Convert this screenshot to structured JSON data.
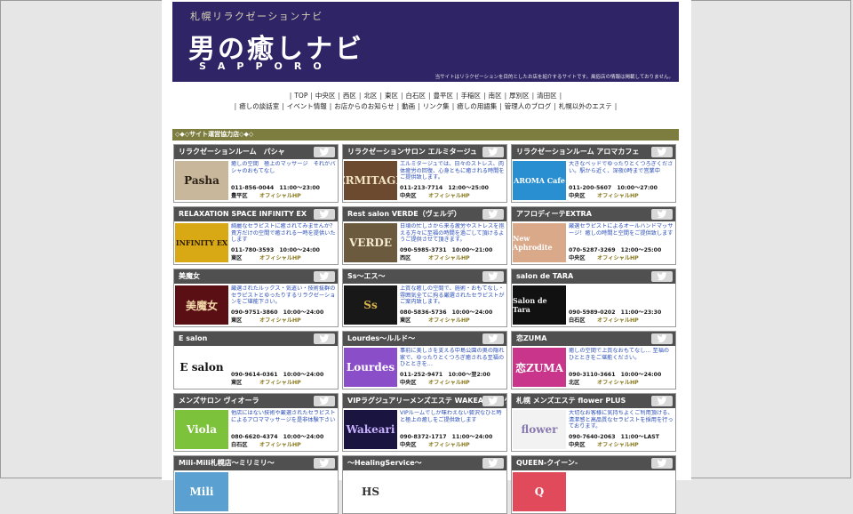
{
  "banner": {
    "kicker": "札幌リラクゼーションナビ",
    "title": "男の癒しナビ",
    "subtitle": "SAPPORO",
    "note": "当サイトはリラクゼーションを目的としたお店を紹介するサイトです。風俗店の情報は掲載しておりません。"
  },
  "nav": {
    "row1": [
      "TOP",
      "中央区",
      "西区",
      "北区",
      "東区",
      "白石区",
      "豊平区",
      "手稲区",
      "南区",
      "厚別区",
      "清田区"
    ],
    "row2": [
      "癒しの談話室",
      "イベント情報",
      "お店からのお知らせ",
      "動画",
      "リンク集",
      "癒しの用語集",
      "管理人のブログ",
      "札幌以外のエステ"
    ]
  },
  "section_title": "◇◆◇サイト運営協力店◇◆◇",
  "hp_label": "オフィシャルHP",
  "cards": [
    {
      "title": "リラクゼーションルーム　パシャ",
      "thumb": "Pasha",
      "thumb_bg": "#c9b79b",
      "thumb_fg": "#2a2016",
      "desc": "癒しの空間　極上のマッサージ　それがパシャのおもてなし",
      "tel": "011-856-0044　11:00～23:00",
      "area": "豊平区"
    },
    {
      "title": "リラクゼーションサロン エルミタージュ",
      "thumb": "ERMITAGE",
      "thumb_bg": "#6b4a30",
      "thumb_fg": "#f0e2c0",
      "desc": "エルミタージュでは、日々のストレス、肉体疲労の回復、心身ともに癒される時間をご提供致します。",
      "tel": "011-213-7714　12:00～25:00",
      "area": "中央区"
    },
    {
      "title": "リラクゼーションルーム アロマカフェ",
      "thumb": "AROMA Cafe",
      "thumb_bg": "#2a8fd0",
      "thumb_fg": "#ffffff",
      "desc": "大きなベッドでゆったりとくつろぎください。駅から近く、深夜0時まで営業中",
      "tel": "011-200-5607　10:00～27:00",
      "area": "中央区"
    },
    {
      "title": "RELAXATION SPACE INFINITY EX",
      "thumb": "INFINITY EX",
      "thumb_bg": "#d9a915",
      "thumb_fg": "#2a1a00",
      "desc": "綺麗なセラピストに癒されてみませんか？貴方だけの空間で癒される一時を提供いたします",
      "tel": "011-780-3593　10:00～24:00",
      "area": "東区"
    },
    {
      "title": "Rest salon VERDE（ヴェルデ）",
      "thumb": "VERDE",
      "thumb_bg": "#6b5a3e",
      "thumb_fg": "#f5ecd2",
      "desc": "日頃の忙しさから来る疲労やストレスを抱える方々に至福の時間を過ごして頂けるようご提供させて頂きます。",
      "tel": "090-5985-3731　10:00～21:00",
      "area": "西区"
    },
    {
      "title": "アフロディーテEXTRA",
      "thumb": "New Aphrodite",
      "thumb_bg": "#d9a98a",
      "thumb_fg": "#ffffff",
      "desc": "厳選セラピストによるオールハンドマッサージ！癒しの時間と空間をご提供致します",
      "tel": "070-5287-3269　12:00～25:00",
      "area": "中央区"
    },
    {
      "title": "美魔女",
      "thumb": "美魔女",
      "thumb_bg": "#5a0f14",
      "thumb_fg": "#f2d7a8",
      "desc": "厳選されたルックス・気遣い・技術抜群のセラピストとゆったりするリラクゼーションをご堪能下さい。",
      "tel": "090-9751-3860　10:00～24:00",
      "area": "東区"
    },
    {
      "title": "Ss～エス～",
      "thumb": "Ss",
      "thumb_bg": "#181818",
      "thumb_fg": "#d8b24a",
      "desc": "上質な癒しの空間で、施術・おもてなし・雰囲気全てに拘る厳選されたセラピストがご案内致します。",
      "tel": "080-5836-5736　10:00～24:00",
      "area": "東区"
    },
    {
      "title": "salon de TARA",
      "thumb": "Salon de Tara",
      "thumb_bg": "#111111",
      "thumb_fg": "#f0f0f0",
      "desc": "",
      "tel": "090-5989-0202　11:00～23:30",
      "area": "白石区"
    },
    {
      "title": "E salon",
      "thumb": "E salon",
      "thumb_bg": "#ffffff",
      "thumb_fg": "#111111",
      "desc": "",
      "tel": "090-9614-0361　10:00～24:00",
      "area": "東区"
    },
    {
      "title": "Lourdes～ルルド～",
      "thumb": "Lourdes",
      "thumb_bg": "#8a4fc8",
      "thumb_fg": "#ffffff",
      "desc": "事前に美しさを支える中島公園の奥の隠れ家で、ゆったりとくつろぎ癒される至福のひとときを…",
      "tel": "011-252-9471　10:00～翌2:00",
      "area": "中央区"
    },
    {
      "title": "恋ZUMA",
      "thumb": "恋ZUMA",
      "thumb_bg": "#c8358a",
      "thumb_fg": "#ffffff",
      "desc": "癒しの空間で上質なおもてなし… 至福のひとときをご堪能ください。",
      "tel": "090-3110-3661　10:00～24:00",
      "area": "北区"
    },
    {
      "title": "メンズサロン ヴィオーラ",
      "thumb": "Viola",
      "thumb_bg": "#7cc23a",
      "thumb_fg": "#ffffff",
      "desc": "他店にはない技術や厳選されたセラピストによるアロママッサージを是非体験下さい",
      "tel": "080-6620-4374　10:00～24:00",
      "area": "白石区"
    },
    {
      "title": "VIPラグジュアリーメンズエステ WAKEARI -ワケアリ-",
      "thumb": "Wakeari",
      "thumb_bg": "#1a1440",
      "thumb_fg": "#c8b0ff",
      "desc": "VIPルームでしか味わえない贅沢なひと時と極上の癒しをご提供致します",
      "tel": "090-8372-1717　11:00～24:00",
      "area": "中央区"
    },
    {
      "title": "札幌 メンズエステ flower PLUS",
      "thumb": "flower",
      "thumb_bg": "#f2f2f2",
      "thumb_fg": "#8a7ab0",
      "desc": "大切なお客様に気持ちよくご利用頂ける、清潔感と高品質なセラピストを採用を行っております。",
      "tel": "090-7640-2063　11:00～LAST",
      "area": "中央区"
    },
    {
      "title": "Mili-Mili札幌店～ミリミリ～",
      "thumb": "Mili",
      "thumb_bg": "#5aa0d0",
      "thumb_fg": "#ffffff",
      "desc": "",
      "tel": "",
      "area": ""
    },
    {
      "title": "～HealingService～",
      "thumb": "HS",
      "thumb_bg": "#ffffff",
      "thumb_fg": "#333333",
      "desc": "",
      "tel": "",
      "area": ""
    },
    {
      "title": "QUEEN-クイーン-",
      "thumb": "Q",
      "thumb_bg": "#e04a5a",
      "thumb_fg": "#ffffff",
      "desc": "",
      "tel": "",
      "area": ""
    }
  ]
}
